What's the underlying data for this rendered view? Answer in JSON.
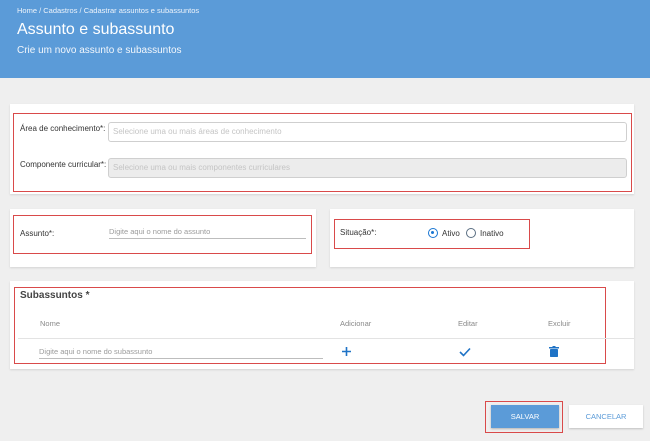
{
  "header": {
    "breadcrumb": "Home / Cadastros / Cadastrar assuntos e subassuntos",
    "title": "Assunto e subassunto",
    "subtitle": "Crie um novo assunto e subassuntos"
  },
  "form": {
    "area_label": "Área de conhecimento*:",
    "area_placeholder": "Selecione uma ou mais áreas de conhecimento",
    "componente_label": "Componente curricular*:",
    "componente_placeholder": "Selecione uma ou mais componentes curriculares",
    "assunto_label": "Assunto*:",
    "assunto_placeholder": "Digite aqui o nome do assunto",
    "situacao_label": "Situação*:",
    "situacao_options": [
      "Ativo",
      "Inativo"
    ],
    "situacao_selected": "Ativo"
  },
  "subassuntos": {
    "title": "Subassuntos *",
    "columns": [
      "Nome",
      "Adicionar",
      "Editar",
      "Excluir"
    ],
    "input_placeholder": "Digite aqui o nome do subassunto",
    "icons": {
      "add": "plus-icon",
      "edit": "check-icon",
      "delete": "trash-icon"
    }
  },
  "actions": {
    "save": "SALVAR",
    "cancel": "CANCELAR"
  },
  "colors": {
    "primary": "#5b9bd8",
    "highlight": "#d94a4a",
    "radio": "#1976d2"
  }
}
